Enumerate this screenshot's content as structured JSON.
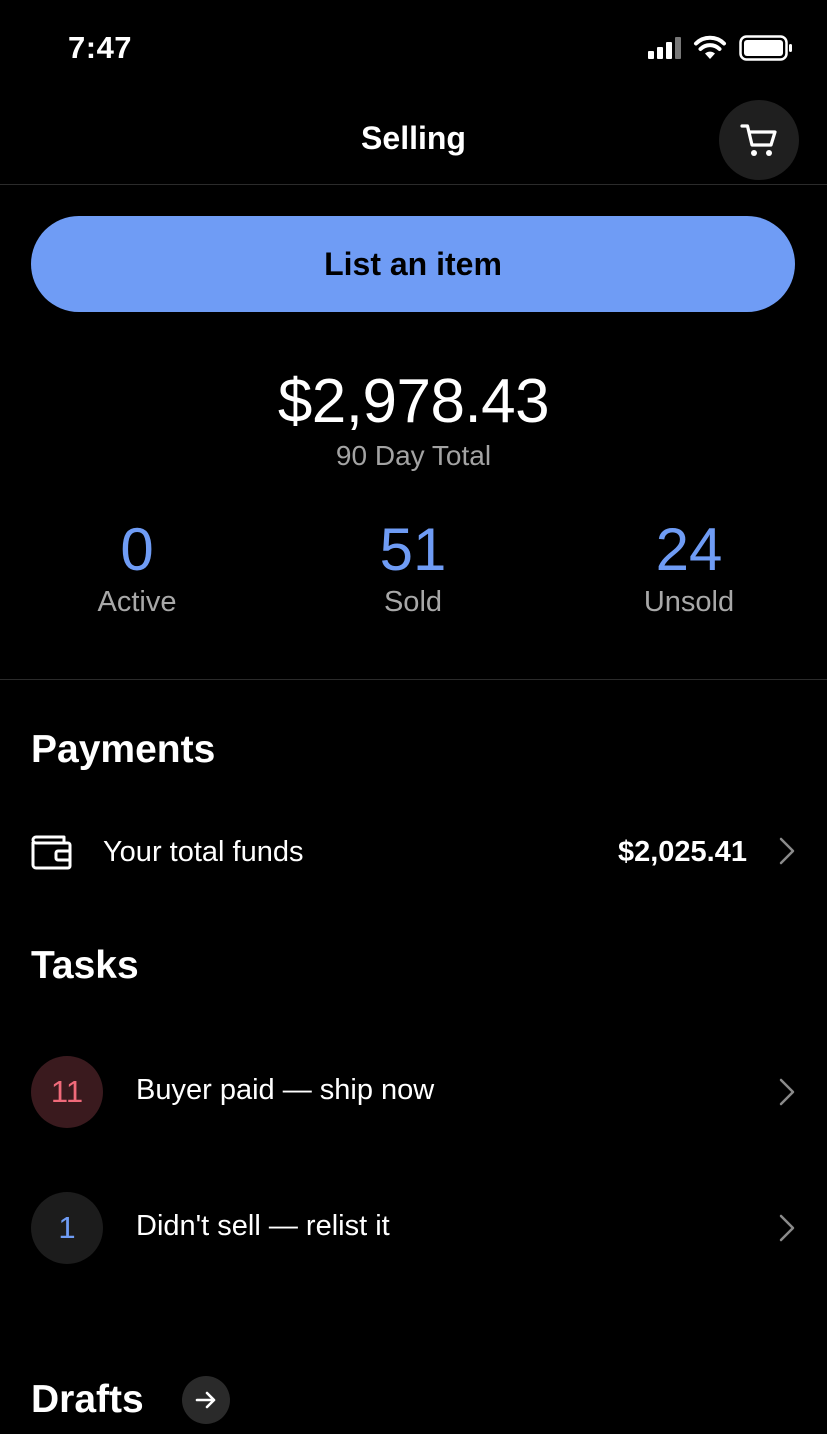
{
  "status_bar": {
    "time": "7:47"
  },
  "nav": {
    "title": "Selling",
    "cart_icon": "shopping-cart-icon"
  },
  "list_button": {
    "label": "List an item"
  },
  "summary": {
    "total": "$2,978.43",
    "total_label": "90 Day Total",
    "stats": [
      {
        "value": "0",
        "label": "Active"
      },
      {
        "value": "51",
        "label": "Sold"
      },
      {
        "value": "24",
        "label": "Unsold"
      }
    ]
  },
  "payments": {
    "heading": "Payments",
    "funds_label": "Your total funds",
    "funds_value": "$2,025.41"
  },
  "tasks": {
    "heading": "Tasks",
    "items": [
      {
        "count": "11",
        "label": "Buyer paid — ship now",
        "badge_bg": "#3a1a1e",
        "badge_color": "#f06a7a"
      },
      {
        "count": "1",
        "label": "Didn't sell — relist it",
        "badge_bg": "#1c1c1c",
        "badge_color": "#6f9cf5"
      }
    ]
  },
  "drafts": {
    "heading": "Drafts"
  },
  "colors": {
    "accent": "#6f9cf5",
    "background": "#000000"
  }
}
